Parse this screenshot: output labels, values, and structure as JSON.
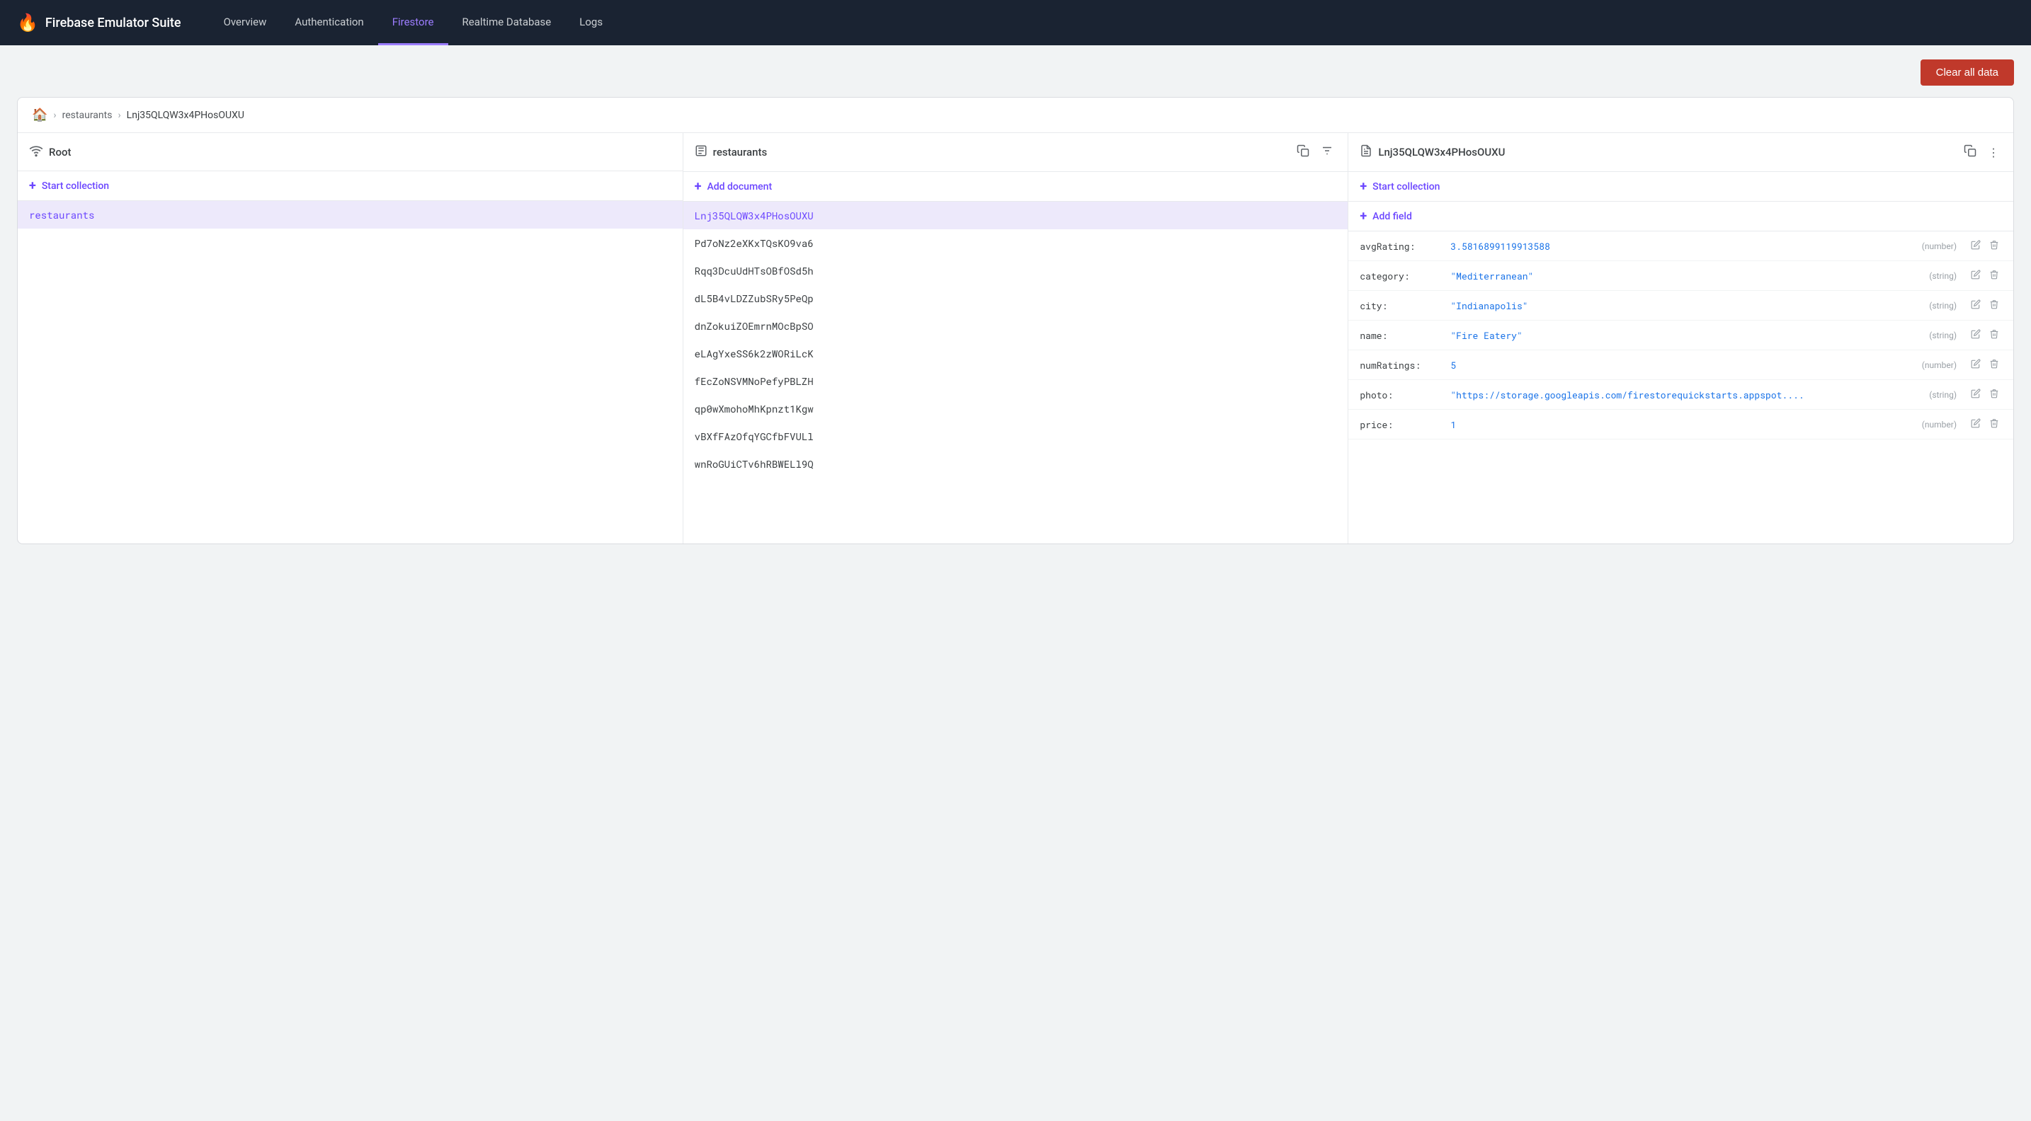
{
  "app": {
    "title": "Firebase Emulator Suite",
    "logo": "🔥"
  },
  "nav": {
    "tabs": [
      {
        "id": "overview",
        "label": "Overview",
        "active": false
      },
      {
        "id": "authentication",
        "label": "Authentication",
        "active": false
      },
      {
        "id": "firestore",
        "label": "Firestore",
        "active": true
      },
      {
        "id": "realtime-database",
        "label": "Realtime Database",
        "active": false
      },
      {
        "id": "logs",
        "label": "Logs",
        "active": false
      }
    ]
  },
  "toolbar": {
    "clear_btn": "Clear all data"
  },
  "breadcrumb": {
    "home_icon": "⌂",
    "separator": "›",
    "collection": "restaurants",
    "document": "Lnj35QLQW3x4PHosOUXU"
  },
  "columns": {
    "root": {
      "title": "Root",
      "icon": "wifi",
      "start_collection_label": "Start collection",
      "items": [
        {
          "id": "restaurants",
          "label": "restaurants",
          "active": true
        }
      ]
    },
    "collection": {
      "title": "restaurants",
      "icon": "document_list",
      "add_document_label": "Add document",
      "items": [
        {
          "id": "Lnj35QLQW3x4PHosOUXU",
          "label": "Lnj35QLQW3x4PHosOUXU",
          "active": true
        },
        {
          "id": "Pd7oNz2eXKxTQsKO9va6",
          "label": "Pd7oNz2eXKxTQsKO9va6",
          "active": false
        },
        {
          "id": "Rqq3DcuUdHTsOBfOSd5h",
          "label": "Rqq3DcuUdHTsOBfOSd5h",
          "active": false
        },
        {
          "id": "dL5B4vLDZZubSRy5PeQp",
          "label": "dL5B4vLDZZubSRy5PeQp",
          "active": false
        },
        {
          "id": "dnZokuiZOEmrnMOcBpSO",
          "label": "dnZokuiZOEmrnMOcBpSO",
          "active": false
        },
        {
          "id": "eLAgYxeSS6k2zWORiLcK",
          "label": "eLAgYxeSS6k2zWORiLcK",
          "active": false
        },
        {
          "id": "fEcZoNSVMNoPefyPBLZH",
          "label": "fEcZoNSVMNoPefyPBLZH",
          "active": false
        },
        {
          "id": "qp0wXmohoMhKpnzt1Kgw",
          "label": "qp0wXmohoMhKpnzt1Kgw",
          "active": false
        },
        {
          "id": "vBXfFAzOfqYGCfbFVULl",
          "label": "vBXfFAzOfqYGCfbFVULl",
          "active": false
        },
        {
          "id": "wnRoGUiCTv6hRBWELl9Q",
          "label": "wnRoGUiCTv6hRBWELl9Q",
          "active": false
        }
      ]
    },
    "document": {
      "title": "Lnj35QLQW3x4PHosOUXU",
      "icon": "document",
      "start_collection_label": "Start collection",
      "add_field_label": "Add field",
      "fields": [
        {
          "name": "avgRating:",
          "value": "3.5816899119913588",
          "type": "(number)"
        },
        {
          "name": "category:",
          "value": "\"Mediterranean\"",
          "type": "(string)"
        },
        {
          "name": "city:",
          "value": "\"Indianapolis\"",
          "type": "(string)"
        },
        {
          "name": "name:",
          "value": "\"Fire Eatery\"",
          "type": "(string)"
        },
        {
          "name": "numRatings:",
          "value": "5",
          "type": "(number)"
        },
        {
          "name": "photo:",
          "value": "\"https://storage.googleapis.com/firestorequickstarts.appspot....",
          "type": "(string)"
        },
        {
          "name": "price:",
          "value": "1",
          "type": "(number)"
        }
      ]
    }
  },
  "icons": {
    "home": "⌂",
    "copy": "⧉",
    "filter": "≡",
    "more": "⋮",
    "edit": "✎",
    "delete": "🗑"
  }
}
